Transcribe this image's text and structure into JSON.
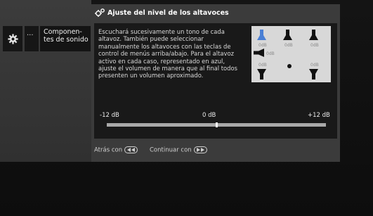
{
  "menu": {
    "settings_icon": "gear-icon",
    "more_label": "...",
    "components_label": "Componen-\ntes de sonido"
  },
  "dialog": {
    "title_icon": "speaker-settings-icon",
    "title": "Ajuste del nivel de los altavoces",
    "description": "Escuchará sucesivamente un tono de cada altavoz. También puede seleccionar manualmente los altavoces con las teclas de control de menús arriba/abajo. Para el altavoz activo en cada caso, representado en azul, ajuste el volumen de manera que al final todos presenten un volumen aproximado.",
    "speakers": {
      "front_left": {
        "level": "0dB",
        "active": true,
        "color": "#4a7fd4"
      },
      "center": {
        "level": "0dB",
        "active": false
      },
      "front_right": {
        "level": "0dB",
        "active": false
      },
      "subwoofer": {
        "level": "0dB",
        "active": false
      },
      "rear_left": {
        "level": "0dB",
        "active": false
      },
      "rear_right": {
        "level": "0dB",
        "active": false
      }
    },
    "scale": {
      "min_label": "-12 dB",
      "mid_label": "0 dB",
      "max_label": "+12 dB",
      "min_db": -12,
      "max_db": 12,
      "value_db": 0
    },
    "footer": {
      "back_label": "Atrás con",
      "back_icon": "rewind-button-icon",
      "continue_label": "Continuar con",
      "continue_icon": "fast-forward-button-icon"
    }
  }
}
